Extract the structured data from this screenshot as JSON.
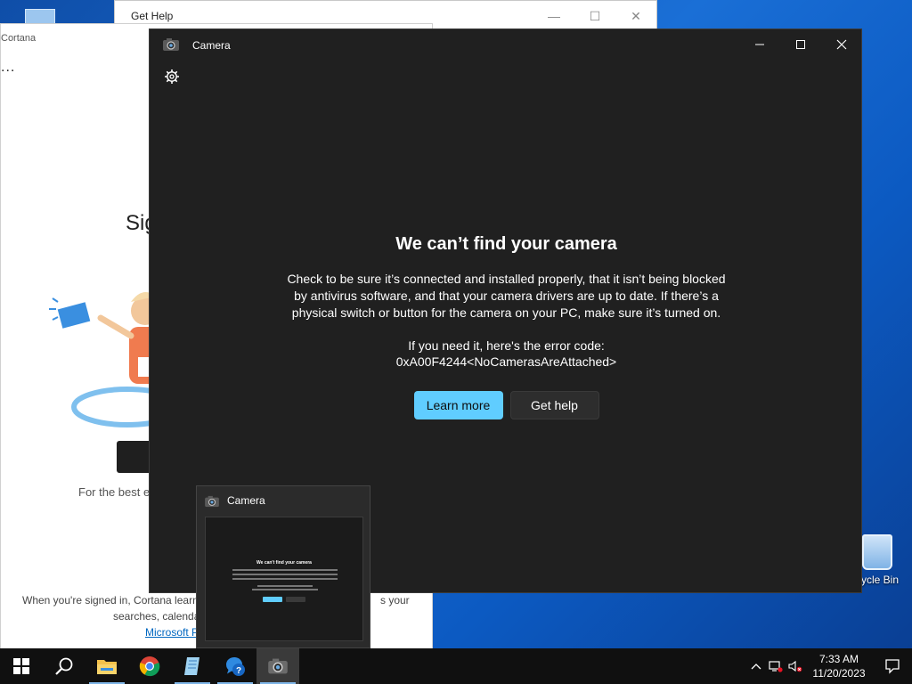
{
  "get_help": {
    "title": "Get Help",
    "minimize": "—",
    "maximize": "☐",
    "close": "✕"
  },
  "cortana": {
    "title": "Cortana",
    "menu_dots": "...",
    "heading_fragment": "Sig",
    "best_fragment": "For the best e",
    "signed_in_text": "When you're signed in, Cortana learns",
    "signed_in_tail": "s your",
    "searches_fragment": "searches, calendar",
    "link_fragment": "Microsoft P"
  },
  "camera_window": {
    "title": "Camera",
    "heading": "We can’t find your camera",
    "description": "Check to be sure it’s connected and installed properly, that it isn’t being blocked by antivirus software, and that your camera drivers are up to date. If there’s a physical switch or button for the camera on your PC, make sure it’s turned on.",
    "error_label": "If you need it, here's the error code:",
    "error_code": "0xA00F4244<NoCamerasAreAttached>",
    "learn_more": "Learn more",
    "get_help": "Get help"
  },
  "thumbnail": {
    "title": "Camera",
    "preview_heading": "We can't find your camera"
  },
  "desktop": {
    "recycle_bin_label": "cycle Bin"
  },
  "taskbar": {
    "apps": [
      "start-button",
      "search-button",
      "file-explorer",
      "chrome",
      "notepad",
      "get-help",
      "camera"
    ],
    "active_app": "camera"
  },
  "tray": {
    "time": "7:33 AM",
    "date": "11/20/2023"
  },
  "colors": {
    "accent": "#60cdff",
    "window_bg": "#202020",
    "taskbar": "#101010"
  }
}
